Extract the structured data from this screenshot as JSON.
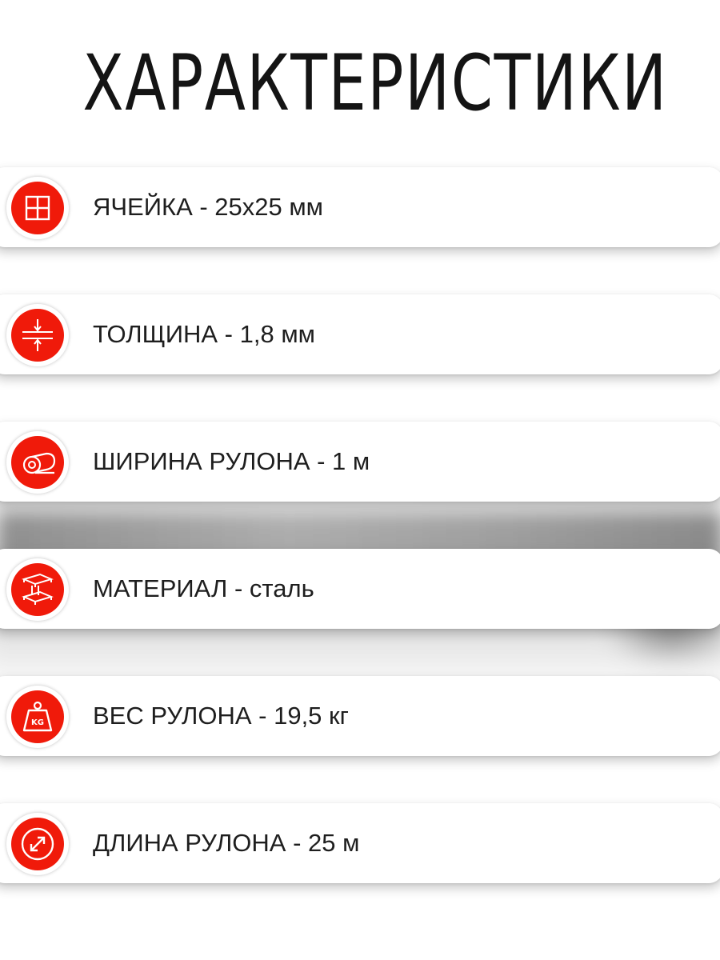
{
  "title": "ХАРАКТЕРИСТИКИ",
  "accent_color": "#f01a0a",
  "items": [
    {
      "icon": "grid-icon",
      "label": "ЯЧЕЙКА - 25х25 мм"
    },
    {
      "icon": "thickness-icon",
      "label": "ТОЛЩИНА - 1,8 мм"
    },
    {
      "icon": "roll-icon",
      "label": "ШИРИНА РУЛОНА - 1 м"
    },
    {
      "icon": "steel-beam-icon",
      "label": "МАТЕРИАЛ - сталь"
    },
    {
      "icon": "weight-icon",
      "label": "ВЕС РУЛОНА - 19,5 кг",
      "icon_text": "KG"
    },
    {
      "icon": "length-arrow-icon",
      "label": "ДЛИНА РУЛОНА - 25 м"
    }
  ]
}
